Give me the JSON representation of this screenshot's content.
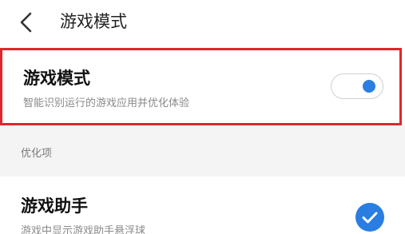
{
  "header": {
    "back_icon": "chevron-left-icon",
    "title": "游戏模式"
  },
  "game_mode": {
    "title": "游戏模式",
    "description": "智能识别运行的游戏应用并优化体验",
    "toggle_on": true,
    "accent_color": "#2a7de1",
    "highlight_border_color": "#e0262d"
  },
  "optimization_section": {
    "label": "优化项"
  },
  "game_assistant": {
    "title": "游戏助手",
    "description": "游戏中显示游戏助手悬浮球",
    "checked": true,
    "check_icon": "checkmark-icon"
  }
}
